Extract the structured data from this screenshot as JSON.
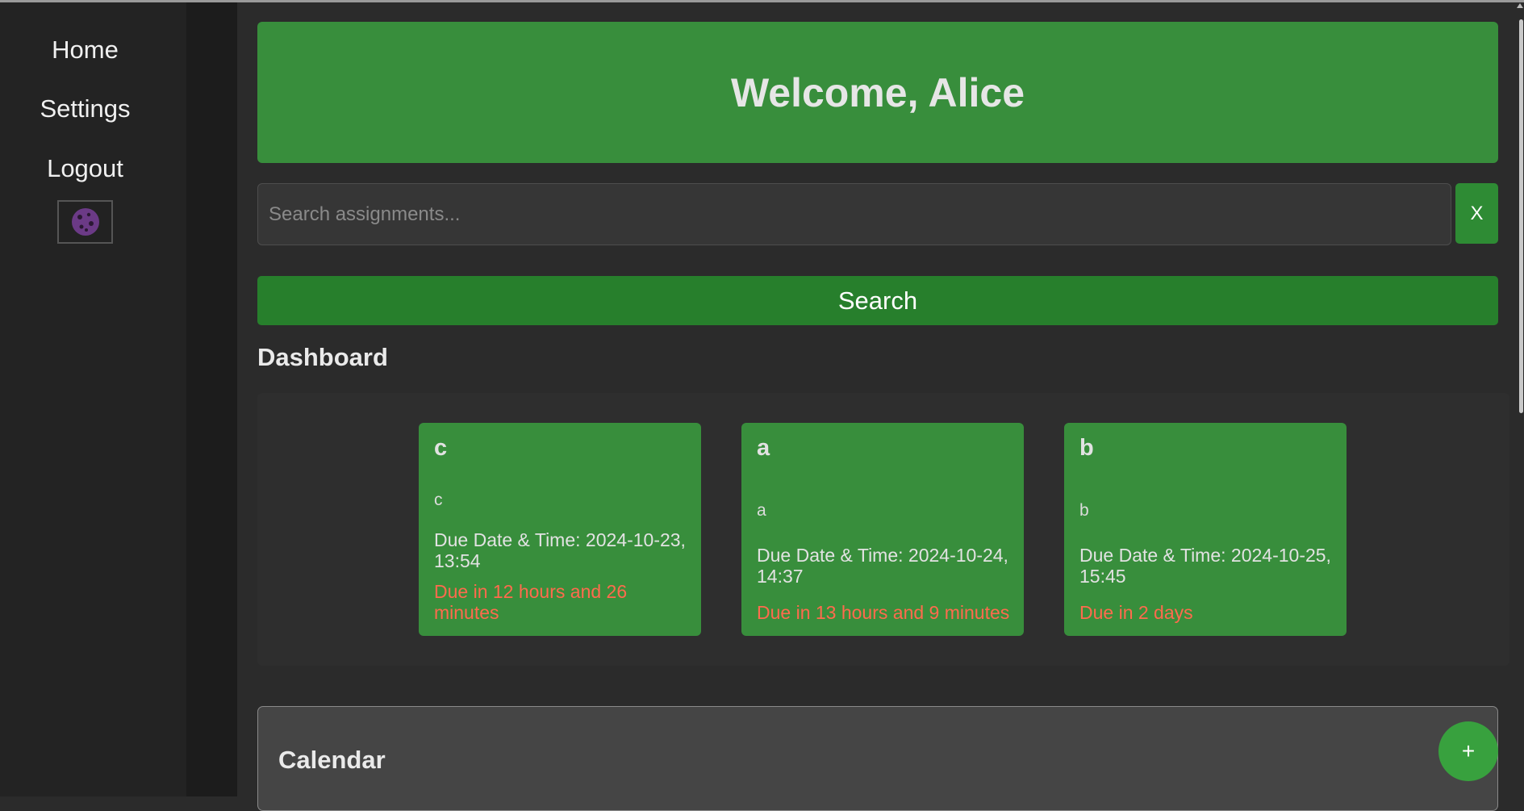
{
  "sidebar": {
    "items": [
      {
        "label": "Home"
      },
      {
        "label": "Settings"
      },
      {
        "label": "Logout"
      }
    ],
    "theme_icon": "cookie-icon"
  },
  "header": {
    "welcome": "Welcome, Alice"
  },
  "search": {
    "placeholder": "Search assignments...",
    "value": "",
    "clear_label": "X",
    "button_label": "Search"
  },
  "dashboard": {
    "title": "Dashboard",
    "cards": [
      {
        "title": "c",
        "description": "c",
        "due": "Due Date & Time: 2024-10-23, 13:54",
        "remaining": "Due in 12 hours and 26 minutes"
      },
      {
        "title": "a",
        "description": "a",
        "due": "Due Date & Time: 2024-10-24, 14:37",
        "remaining": "Due in 13 hours and 9 minutes"
      },
      {
        "title": "b",
        "description": "b",
        "due": "Due Date & Time: 2024-10-25, 15:45",
        "remaining": "Due in 2 days"
      }
    ]
  },
  "calendar": {
    "title": "Calendar",
    "add_label": "+"
  },
  "colors": {
    "accent": "#388e3c",
    "button": "#277f2c",
    "due_warning": "#ff6b4d",
    "background": "#2b2b2b",
    "sidebar": "#232323"
  }
}
